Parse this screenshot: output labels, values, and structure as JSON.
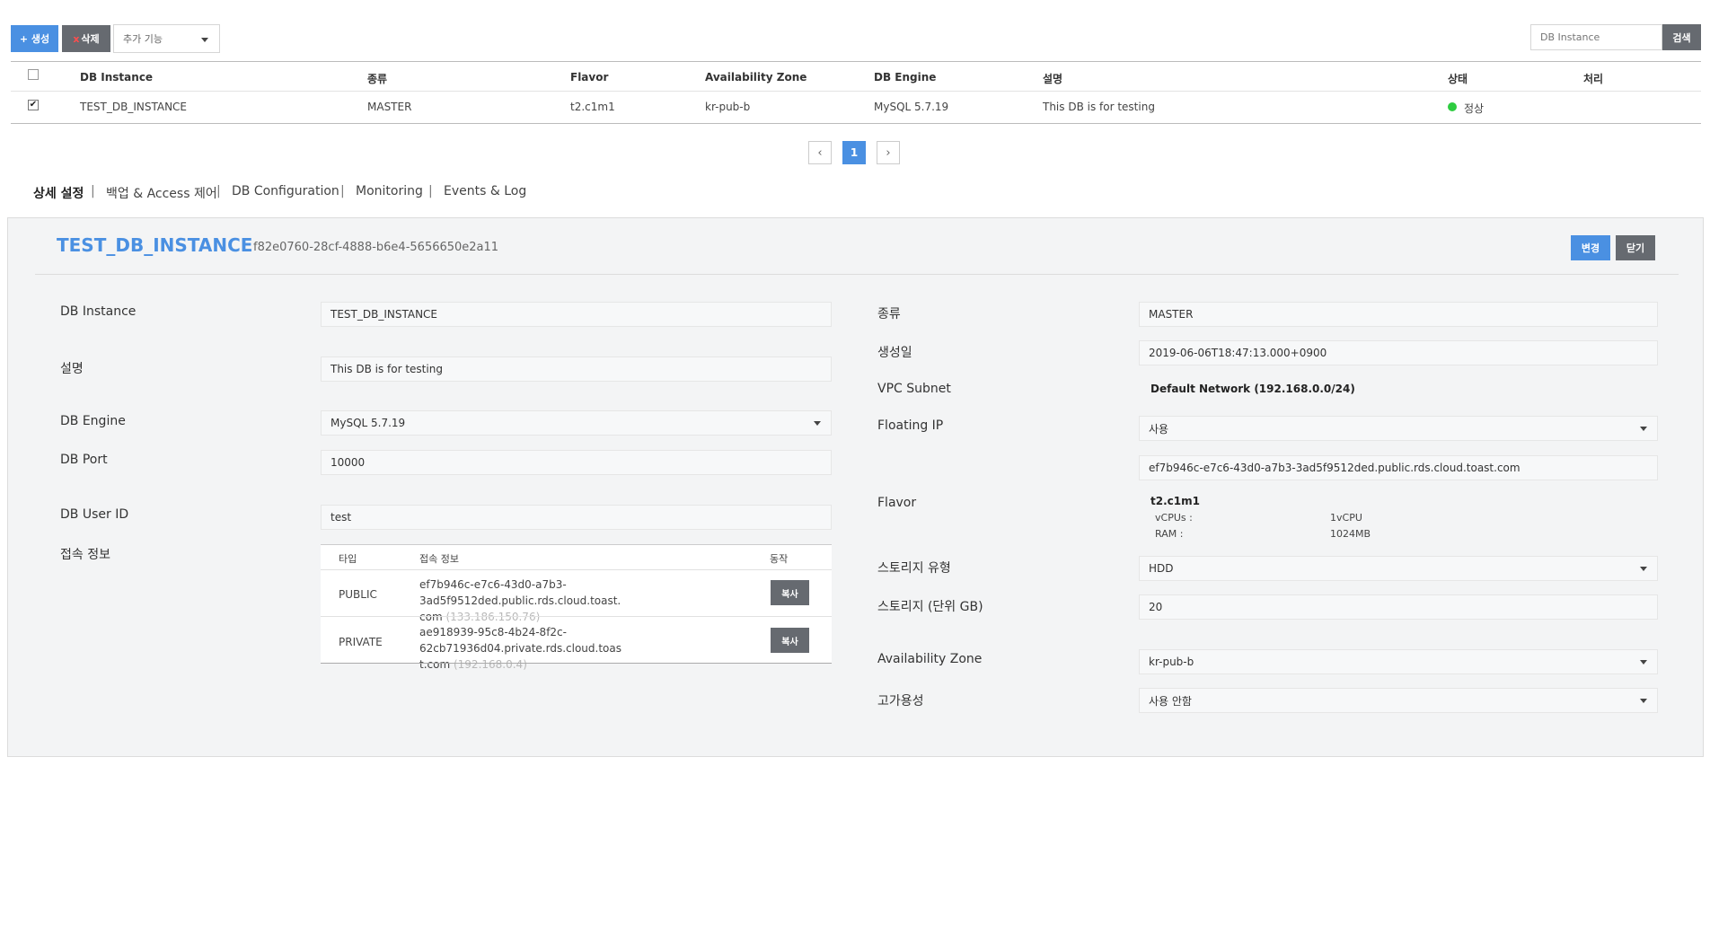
{
  "toolbar": {
    "create_label": "+ 생성",
    "delete_x": "x",
    "delete_label": "삭제",
    "more_label": "추가 기능",
    "search_placeholder": "DB Instance",
    "search_label": "검색"
  },
  "list": {
    "headers": [
      "DB Instance",
      "종류",
      "Flavor",
      "Availability Zone",
      "DB Engine",
      "설명",
      "상태",
      "처리"
    ],
    "rows": [
      {
        "checked": true,
        "name": "TEST_DB_INSTANCE",
        "type": "MASTER",
        "flavor": "t2.c1m1",
        "zone": "kr-pub-b",
        "engine": "MySQL 5.7.19",
        "description": "This DB is for testing",
        "status": "정상",
        "status_color": "#2ecc40"
      }
    ]
  },
  "pager": {
    "prev": "‹",
    "current": "1",
    "next": "›"
  },
  "tabs": [
    "상세 설정",
    "백업 & Access 제어",
    "DB Configuration",
    "Monitoring",
    "Events & Log"
  ],
  "tab_separator": "|",
  "detail": {
    "title": "TEST_DB_INSTANCE",
    "uuid": "f82e0760-28cf-4888-b6e4-5656650e2a11",
    "edit_label": "변경",
    "close_label": "닫기",
    "left": {
      "db_instance_label": "DB Instance",
      "db_instance_value": "TEST_DB_INSTANCE",
      "desc_label": "설명",
      "desc_value": "This DB is for testing",
      "engine_label": "DB Engine",
      "engine_value": "MySQL 5.7.19",
      "port_label": "DB Port",
      "port_value": "10000",
      "user_label": "DB User ID",
      "user_value": "test",
      "conn_label": "접속 정보",
      "conn_headers": [
        "타입",
        "접속 정보",
        "동작"
      ],
      "conn_rows": [
        {
          "type": "PUBLIC",
          "host1": "ef7b946c-e7c6-43d0-a7b3-3ad5f9512ded.public.rds.cloud.toast.",
          "host2": "com",
          "ip": "(133.186.150.76)",
          "action": "복사"
        },
        {
          "type": "PRIVATE",
          "host1": "ae918939-95c8-4b24-8f2c-62cb71936d04.private.rds.cloud.toas",
          "host2": "t.com",
          "ip": "(192.168.0.4)",
          "action": "복사"
        }
      ]
    },
    "right": {
      "kind_label": "종류",
      "kind_value": "MASTER",
      "created_label": "생성일",
      "created_value": "2019-06-06T18:47:13.000+0900",
      "vpc_label": "VPC Subnet",
      "vpc_value": "Default Network (192.168.0.0/24)",
      "fip_label": "Floating IP",
      "fip_value": "사용",
      "fip_host": "ef7b946c-e7c6-43d0-a7b3-3ad5f9512ded.public.rds.cloud.toast.com",
      "flavor_label": "Flavor",
      "flavor_name": "t2.c1m1",
      "vcpu_label": "vCPUs :",
      "vcpu_value": "1vCPU",
      "ram_label": "RAM :",
      "ram_value": "1024MB",
      "storage_type_label": "스토리지 유형",
      "storage_type_value": "HDD",
      "storage_size_label": "스토리지 (단위 GB)",
      "storage_size_value": "20",
      "zone_label": "Availability Zone",
      "zone_value": "kr-pub-b",
      "ha_label": "고가용성",
      "ha_value": "사용 안함"
    }
  },
  "colors": {
    "accent": "#4a90e2",
    "button_gray": "#666a70",
    "panel_bg": "#f3f4f5"
  }
}
